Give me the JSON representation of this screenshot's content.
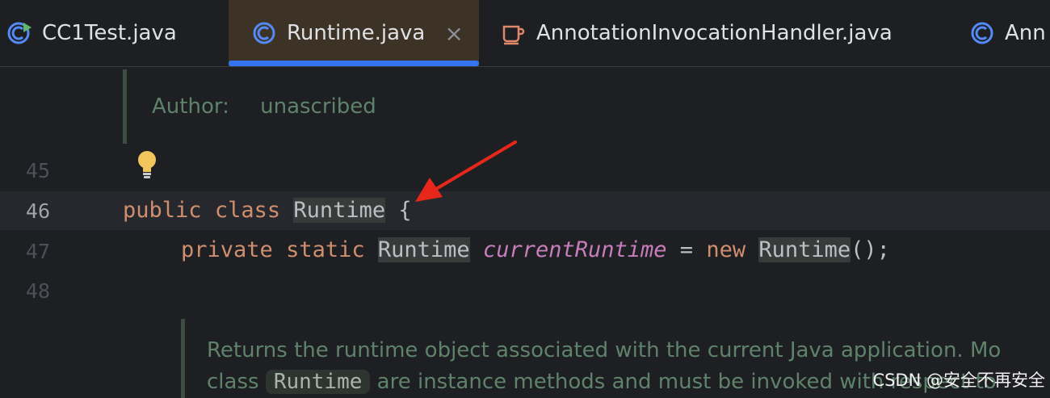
{
  "tabs": [
    {
      "label": "CC1Test.java",
      "icon": "class-run-icon",
      "active": false
    },
    {
      "label": "Runtime.java",
      "icon": "class-icon",
      "active": true,
      "close": "×"
    },
    {
      "label": "AnnotationInvocationHandler.java",
      "icon": "coffee-cup-icon",
      "active": false
    },
    {
      "label": "Ann",
      "icon": "class-icon",
      "active": false
    }
  ],
  "doc_author": {
    "label": "Author:",
    "value": "unascribed"
  },
  "line_numbers": {
    "l45": "45",
    "l46": "46",
    "l47": "47",
    "l48": "48"
  },
  "code": {
    "line46": {
      "kw1": "public",
      "kw2": "class",
      "name": "Runtime",
      "brace": "{"
    },
    "line47": {
      "kw1": "private",
      "kw2": "static",
      "type": "Runtime",
      "field": "currentRuntime",
      "eq": "=",
      "kw3": "new",
      "ctor": "Runtime",
      "tail": "();"
    }
  },
  "javadoc": {
    "line1": "Returns the runtime object associated with the current Java application. Mo",
    "line2_pre": "class",
    "line2_code": "Runtime",
    "line2_post": "are instance methods and must be invoked with respect to"
  },
  "watermark": "CSDN @安全不再安全",
  "colors": {
    "keyword": "#cf8e6d",
    "field": "#c77dbb",
    "doc": "#5f826b",
    "accent": "#3574f0",
    "annotation_arrow": "#e8271b"
  }
}
